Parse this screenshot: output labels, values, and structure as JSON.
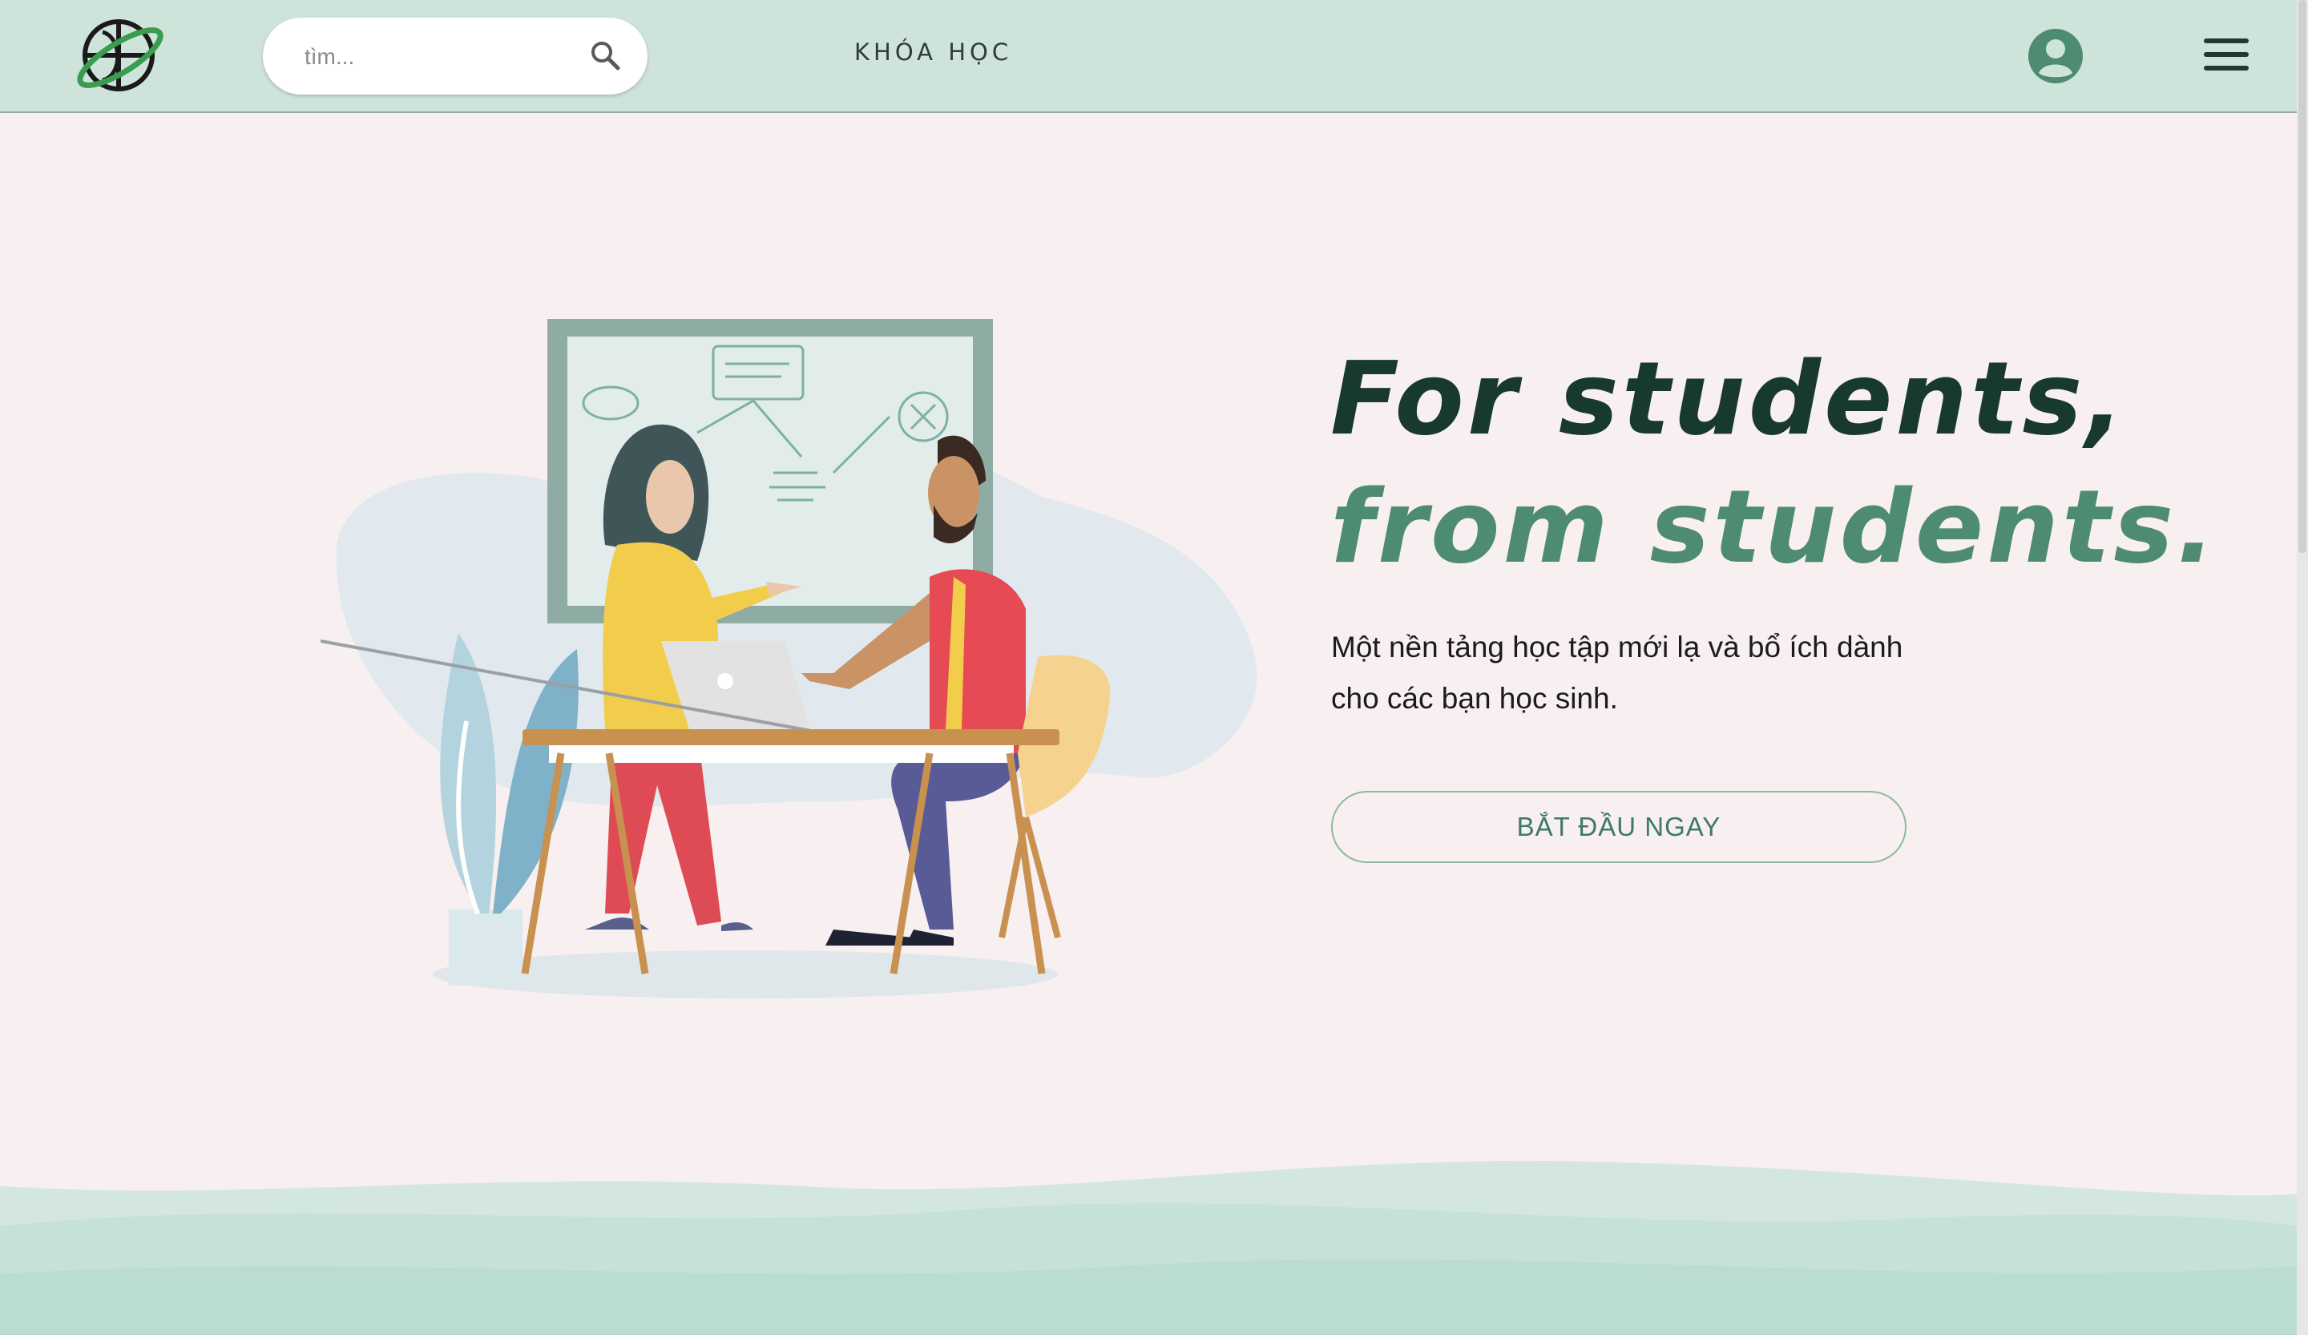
{
  "header": {
    "search_placeholder": "tìm...",
    "nav_courses": "KHÓA HỌC",
    "icons": {
      "logo": "globe-logo",
      "search": "search-icon",
      "user": "user-circle-icon",
      "menu": "hamburger-icon"
    }
  },
  "hero": {
    "title_line1": "For students,",
    "title_line2": "from students.",
    "description": "Một nền tảng học tập mới lạ và bổ ích dành cho các bạn học sinh.",
    "cta_label": "BẮT ĐẦU NGAY"
  },
  "colors": {
    "header_bg": "#cee3da",
    "page_bg": "#f8eff0",
    "title_dark": "#173a2c",
    "title_accent": "#4e8b73",
    "wave": "#c6e2d6"
  }
}
